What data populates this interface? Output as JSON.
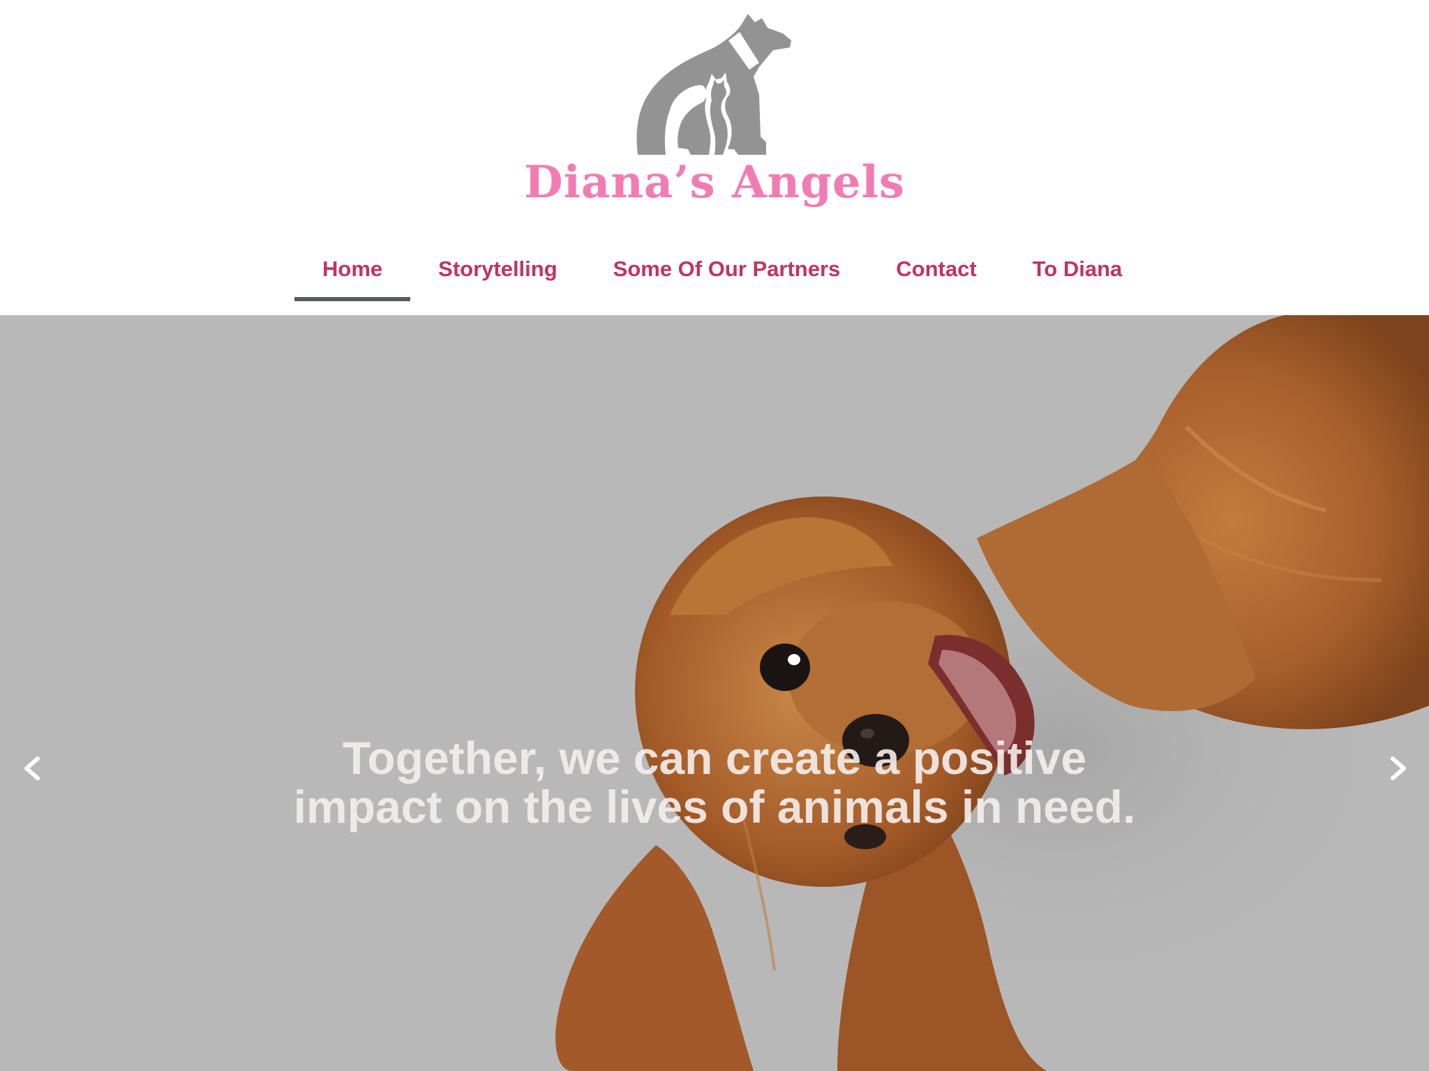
{
  "brand": {
    "name": "Diana’s Angels",
    "logo_icon": "dog-and-cat-silhouette-icon",
    "logo_color": "#939393",
    "name_color": "#f27bb4"
  },
  "nav": {
    "items": [
      {
        "label": "Home",
        "active": true
      },
      {
        "label": "Storytelling",
        "active": false
      },
      {
        "label": "Some Of Our Partners",
        "active": false
      },
      {
        "label": "Contact",
        "active": false
      },
      {
        "label": "To Diana",
        "active": false
      }
    ],
    "link_color": "#c2335f",
    "active_underline_color": "#555a5e"
  },
  "hero": {
    "image": "puppy-upside-down-photo",
    "background_color": "#b8b8b8",
    "headline_line1": "Together, we can create a positive",
    "headline_line2": "impact on the lives of animals in need.",
    "prev_icon": "chevron-left-icon",
    "next_icon": "chevron-right-icon"
  }
}
